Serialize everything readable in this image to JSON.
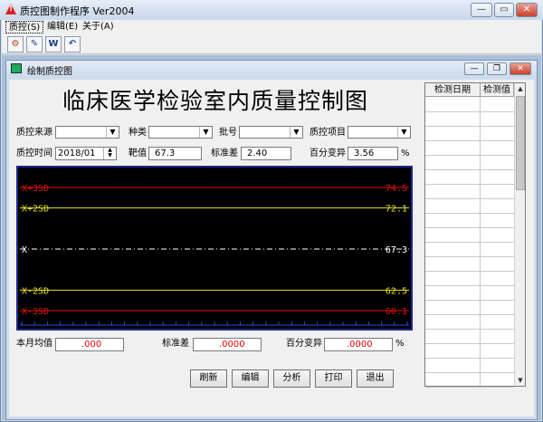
{
  "window": {
    "title": "质控图制作程序 Ver2004",
    "controls": [
      "minimize",
      "maximize",
      "close"
    ]
  },
  "menu": [
    {
      "label": "质控(S)",
      "selected": true
    },
    {
      "label": "编辑(E)"
    },
    {
      "label": "关于(A)"
    }
  ],
  "toolbar": [
    {
      "icon": "tool-1-icon",
      "glyph": "⚙"
    },
    {
      "icon": "tool-2-icon",
      "glyph": "✎"
    },
    {
      "icon": "word-icon",
      "glyph": "W"
    },
    {
      "icon": "undo-icon",
      "glyph": "↶"
    }
  ],
  "child_window": {
    "title": "绘制质控图"
  },
  "form": {
    "heading": "临床医学检验室内质量控制图",
    "row1": {
      "source_label": "质控来源",
      "type_label": "种类",
      "lot_label": "批号",
      "item_label": "质控项目"
    },
    "row2": {
      "time_label": "质控时间",
      "time_value": "2018/01",
      "target_label": "靶值",
      "target_value": "67.3",
      "sd_label": "标准差",
      "sd_value": "2.40",
      "cv_label": "百分变异",
      "cv_value": "3.56",
      "cv_unit": "%"
    },
    "row3": {
      "mean_label": "本月均值",
      "mean_value": ".000",
      "sd_label": "标准差",
      "sd_value": ".0000",
      "cv_label": "百分变异",
      "cv_value": ".0000",
      "cv_unit": "%"
    }
  },
  "chart_data": {
    "type": "line",
    "description_lines": [
      {
        "name": "X+3SD",
        "value": 74.5,
        "color": "#e01010",
        "style": "solid"
      },
      {
        "name": "X+2SD",
        "value": 72.1,
        "color": "#e8e020",
        "style": "solid"
      },
      {
        "name": "X",
        "value": 67.3,
        "color": "#ffffff",
        "style": "dashdot"
      },
      {
        "name": "X-2SD",
        "value": 62.5,
        "color": "#e8e020",
        "style": "solid"
      },
      {
        "name": "X-3SD",
        "value": 60.1,
        "color": "#e01010",
        "style": "solid"
      }
    ],
    "labels": {
      "X+3SD": {
        "left": "X+3SD",
        "right": "74.5"
      },
      "X+2SD": {
        "left": "X+2SD",
        "right": "72.1"
      },
      "X": {
        "left": "X",
        "right": "67.3"
      },
      "X-2SD": {
        "left": "X-2SD",
        "right": "62.5"
      },
      "X-3SD": {
        "left": "X-3SD",
        "right": "60.1"
      }
    },
    "background": "#000000",
    "x_ticks": 31,
    "points": []
  },
  "table": {
    "columns": [
      "检测日期",
      "检测值"
    ],
    "rows": []
  },
  "buttons": {
    "refresh": "刷新",
    "edit": "编辑",
    "analyze": "分析",
    "print": "打印",
    "exit": "退出"
  }
}
